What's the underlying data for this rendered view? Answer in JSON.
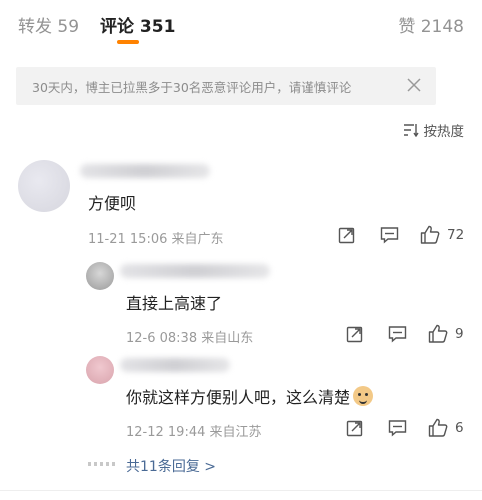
{
  "tabs": [
    {
      "label": "转发",
      "count": "59"
    },
    {
      "label": "评论",
      "count": "351"
    },
    {
      "label": "赞",
      "count": "2148"
    }
  ],
  "notice": {
    "text": "30天内，博主已拉黑多于30名恶意评论用户，请谨慎评论"
  },
  "sort": {
    "label": "按热度"
  },
  "comments": [
    {
      "content": "方便呗",
      "time": "11-21 15:06",
      "location": "来自广东",
      "likes": "72"
    },
    {
      "content": "直接上高速了",
      "time": "12-6 08:38",
      "location": "来自山东",
      "likes": "9"
    },
    {
      "content": "你就这样方便别人吧，这么清楚",
      "time": "12-12 19:44",
      "location": "来自江苏",
      "likes": "6"
    }
  ],
  "more_replies": "共11条回复 >",
  "colors": {
    "accent": "#ff8200",
    "link": "#4a6a95"
  }
}
